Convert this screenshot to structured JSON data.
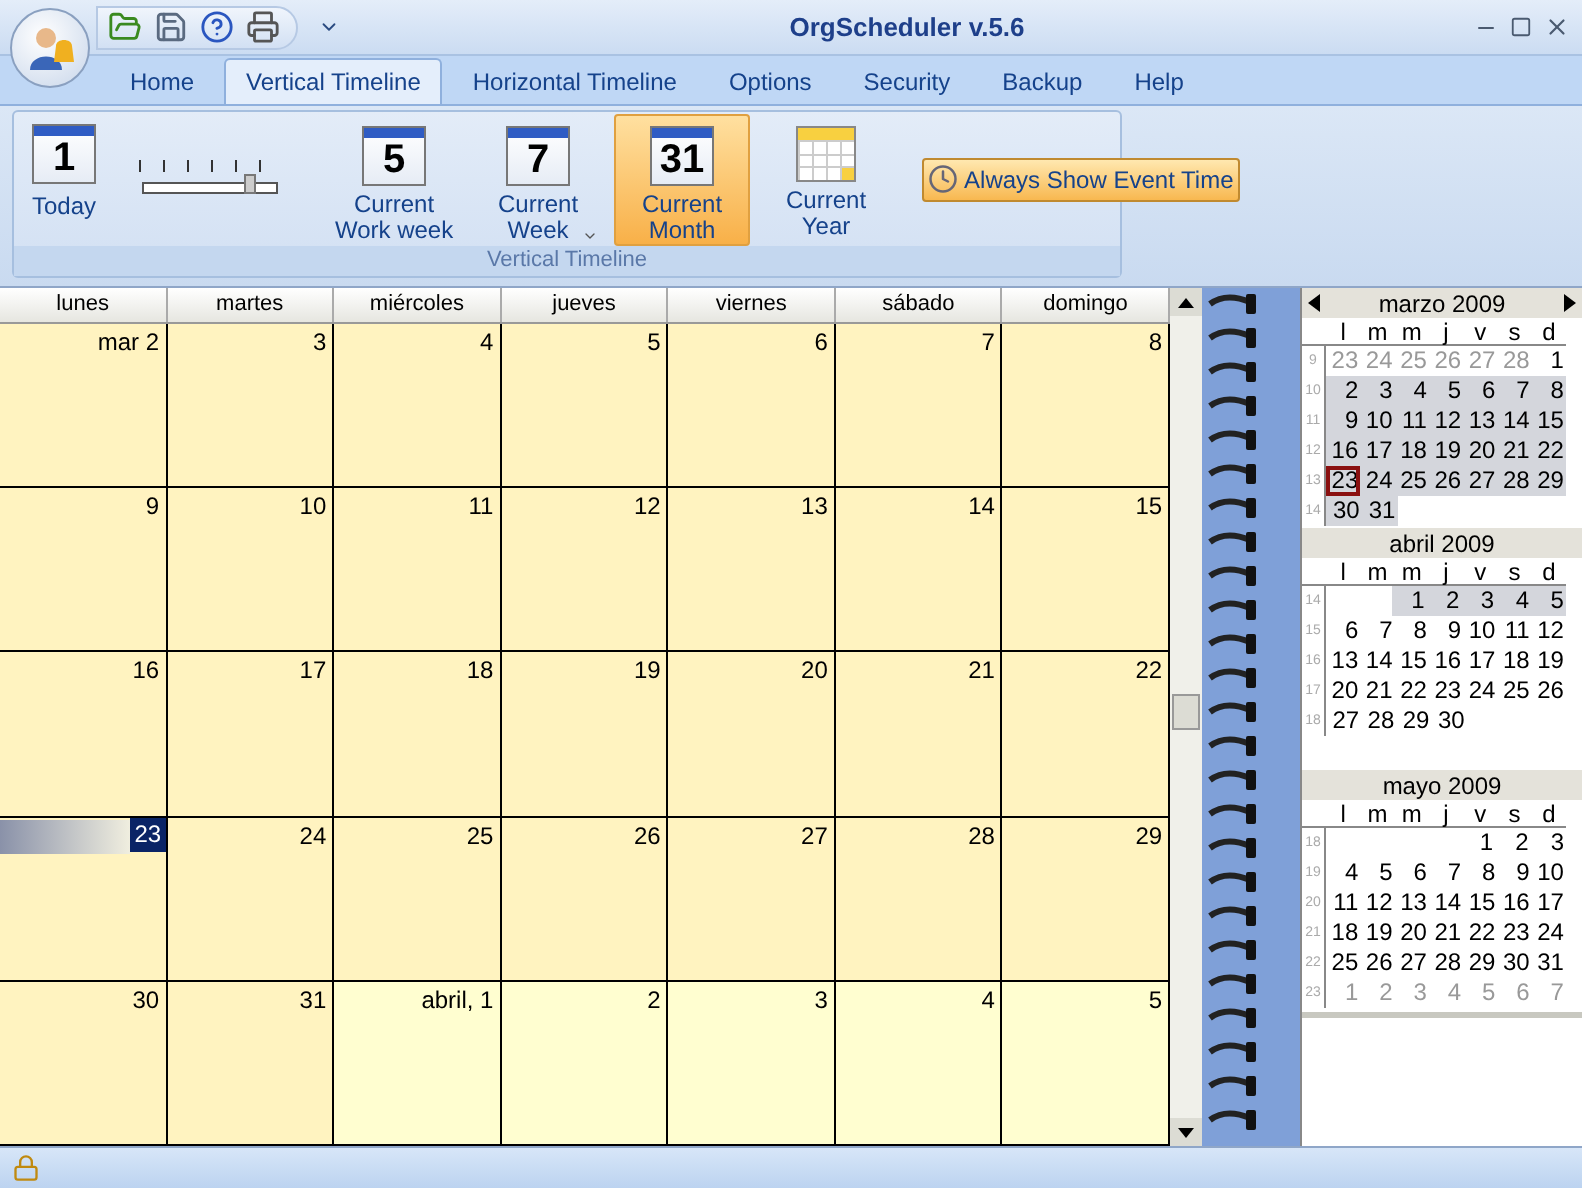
{
  "window": {
    "title": "OrgScheduler v.5.6"
  },
  "tabs": [
    {
      "label": "Home",
      "selected": false
    },
    {
      "label": "Vertical Timeline",
      "selected": true
    },
    {
      "label": "Horizontal Timeline",
      "selected": false
    },
    {
      "label": "Options",
      "selected": false
    },
    {
      "label": "Security",
      "selected": false
    },
    {
      "label": "Backup",
      "selected": false
    },
    {
      "label": "Help",
      "selected": false
    }
  ],
  "ribbon": {
    "group_label": "Vertical Timeline",
    "today": {
      "icon_text": "1",
      "label": "Today"
    },
    "zoom_slider": {
      "level": 0.8
    },
    "view_buttons": [
      {
        "kind": "number",
        "icon_text": "5",
        "label": "Current Work week",
        "selected": false,
        "dropdown": false
      },
      {
        "kind": "number",
        "icon_text": "7",
        "label": "Current Week",
        "selected": false,
        "dropdown": true
      },
      {
        "kind": "number",
        "icon_text": "31",
        "label": "Current Month",
        "selected": true,
        "dropdown": false
      },
      {
        "kind": "grid",
        "label": "Current Year",
        "selected": false,
        "dropdown": false
      }
    ],
    "event_time_toggle": {
      "label": "Always Show Event Time",
      "on": true
    }
  },
  "month_view": {
    "day_headers": [
      "lunes",
      "martes",
      "miércoles",
      "jueves",
      "viernes",
      "sábado",
      "domingo"
    ],
    "weeks": [
      [
        {
          "label": "mar 2",
          "selected": false,
          "other_month": false
        },
        {
          "label": "3",
          "selected": false,
          "other_month": false
        },
        {
          "label": "4",
          "selected": false,
          "other_month": false
        },
        {
          "label": "5",
          "selected": false,
          "other_month": false
        },
        {
          "label": "6",
          "selected": false,
          "other_month": false
        },
        {
          "label": "7",
          "selected": false,
          "other_month": false
        },
        {
          "label": "8",
          "selected": false,
          "other_month": false
        }
      ],
      [
        {
          "label": "9",
          "selected": false,
          "other_month": false
        },
        {
          "label": "10",
          "selected": false,
          "other_month": false
        },
        {
          "label": "11",
          "selected": false,
          "other_month": false
        },
        {
          "label": "12",
          "selected": false,
          "other_month": false
        },
        {
          "label": "13",
          "selected": false,
          "other_month": false
        },
        {
          "label": "14",
          "selected": false,
          "other_month": false
        },
        {
          "label": "15",
          "selected": false,
          "other_month": false
        }
      ],
      [
        {
          "label": "16",
          "selected": false,
          "other_month": false
        },
        {
          "label": "17",
          "selected": false,
          "other_month": false
        },
        {
          "label": "18",
          "selected": false,
          "other_month": false
        },
        {
          "label": "19",
          "selected": false,
          "other_month": false
        },
        {
          "label": "20",
          "selected": false,
          "other_month": false
        },
        {
          "label": "21",
          "selected": false,
          "other_month": false
        },
        {
          "label": "22",
          "selected": false,
          "other_month": false
        }
      ],
      [
        {
          "label": "23",
          "selected": true,
          "other_month": false
        },
        {
          "label": "24",
          "selected": false,
          "other_month": false
        },
        {
          "label": "25",
          "selected": false,
          "other_month": false
        },
        {
          "label": "26",
          "selected": false,
          "other_month": false
        },
        {
          "label": "27",
          "selected": false,
          "other_month": false
        },
        {
          "label": "28",
          "selected": false,
          "other_month": false
        },
        {
          "label": "29",
          "selected": false,
          "other_month": false
        }
      ],
      [
        {
          "label": "30",
          "selected": false,
          "other_month": false
        },
        {
          "label": "31",
          "selected": false,
          "other_month": false
        },
        {
          "label": "abril, 1",
          "selected": false,
          "other_month": true
        },
        {
          "label": "2",
          "selected": false,
          "other_month": true
        },
        {
          "label": "3",
          "selected": false,
          "other_month": true
        },
        {
          "label": "4",
          "selected": false,
          "other_month": true
        },
        {
          "label": "5",
          "selected": false,
          "other_month": true
        }
      ]
    ]
  },
  "mini_calendars": [
    {
      "title": "marzo 2009",
      "nav": true,
      "weekdays": [
        "l",
        "m",
        "m",
        "j",
        "v",
        "s",
        "d"
      ],
      "weeks": [
        {
          "number": "9",
          "highlighted": false,
          "days": [
            {
              "kind": "day",
              "label": "23",
              "muted": true,
              "today": false
            },
            {
              "kind": "day",
              "label": "24",
              "muted": true,
              "today": false
            },
            {
              "kind": "day",
              "label": "25",
              "muted": true,
              "today": false
            },
            {
              "kind": "day",
              "label": "26",
              "muted": true,
              "today": false
            },
            {
              "kind": "day",
              "label": "27",
              "muted": true,
              "today": false
            },
            {
              "kind": "day",
              "label": "28",
              "muted": true,
              "today": false
            },
            {
              "kind": "day",
              "label": "1",
              "muted": false,
              "today": false
            }
          ]
        },
        {
          "number": "10",
          "highlighted": true,
          "days": [
            {
              "kind": "day",
              "label": "2",
              "muted": false,
              "today": false
            },
            {
              "kind": "day",
              "label": "3",
              "muted": false,
              "today": false
            },
            {
              "kind": "day",
              "label": "4",
              "muted": false,
              "today": false
            },
            {
              "kind": "day",
              "label": "5",
              "muted": false,
              "today": false
            },
            {
              "kind": "day",
              "label": "6",
              "muted": false,
              "today": false
            },
            {
              "kind": "day",
              "label": "7",
              "muted": false,
              "today": false
            },
            {
              "kind": "day",
              "label": "8",
              "muted": false,
              "today": false
            }
          ]
        },
        {
          "number": "11",
          "highlighted": true,
          "days": [
            {
              "kind": "day",
              "label": "9",
              "muted": false,
              "today": false
            },
            {
              "kind": "day",
              "label": "10",
              "muted": false,
              "today": false
            },
            {
              "kind": "day",
              "label": "11",
              "muted": false,
              "today": false
            },
            {
              "kind": "day",
              "label": "12",
              "muted": false,
              "today": false
            },
            {
              "kind": "day",
              "label": "13",
              "muted": false,
              "today": false
            },
            {
              "kind": "day",
              "label": "14",
              "muted": false,
              "today": false
            },
            {
              "kind": "day",
              "label": "15",
              "muted": false,
              "today": false
            }
          ]
        },
        {
          "number": "12",
          "highlighted": true,
          "days": [
            {
              "kind": "day",
              "label": "16",
              "muted": false,
              "today": false
            },
            {
              "kind": "day",
              "label": "17",
              "muted": false,
              "today": false
            },
            {
              "kind": "day",
              "label": "18",
              "muted": false,
              "today": false
            },
            {
              "kind": "day",
              "label": "19",
              "muted": false,
              "today": false
            },
            {
              "kind": "day",
              "label": "20",
              "muted": false,
              "today": false
            },
            {
              "kind": "day",
              "label": "21",
              "muted": false,
              "today": false
            },
            {
              "kind": "day",
              "label": "22",
              "muted": false,
              "today": false
            }
          ]
        },
        {
          "number": "13",
          "highlighted": true,
          "days": [
            {
              "kind": "day",
              "label": "23",
              "muted": false,
              "today": true
            },
            {
              "kind": "day",
              "label": "24",
              "muted": false,
              "today": false
            },
            {
              "kind": "day",
              "label": "25",
              "muted": false,
              "today": false
            },
            {
              "kind": "day",
              "label": "26",
              "muted": false,
              "today": false
            },
            {
              "kind": "day",
              "label": "27",
              "muted": false,
              "today": false
            },
            {
              "kind": "day",
              "label": "28",
              "muted": false,
              "today": false
            },
            {
              "kind": "day",
              "label": "29",
              "muted": false,
              "today": false
            }
          ]
        },
        {
          "number": "14",
          "highlighted": true,
          "days": [
            {
              "kind": "day",
              "label": "30",
              "muted": false,
              "today": false
            },
            {
              "kind": "day",
              "label": "31",
              "muted": false,
              "today": false
            },
            {
              "kind": "blank"
            },
            {
              "kind": "blank"
            },
            {
              "kind": "blank"
            },
            {
              "kind": "blank"
            },
            {
              "kind": "blank"
            }
          ]
        }
      ]
    },
    {
      "title": "abril 2009",
      "nav": false,
      "weekdays": [
        "l",
        "m",
        "m",
        "j",
        "v",
        "s",
        "d"
      ],
      "weeks": [
        {
          "number": "14",
          "highlighted": true,
          "days": [
            {
              "kind": "blank"
            },
            {
              "kind": "blank"
            },
            {
              "kind": "day",
              "label": "1",
              "muted": false,
              "today": false
            },
            {
              "kind": "day",
              "label": "2",
              "muted": false,
              "today": false
            },
            {
              "kind": "day",
              "label": "3",
              "muted": false,
              "today": false
            },
            {
              "kind": "day",
              "label": "4",
              "muted": false,
              "today": false
            },
            {
              "kind": "day",
              "label": "5",
              "muted": false,
              "today": false
            }
          ]
        },
        {
          "number": "15",
          "highlighted": false,
          "days": [
            {
              "kind": "day",
              "label": "6",
              "muted": false,
              "today": false
            },
            {
              "kind": "day",
              "label": "7",
              "muted": false,
              "today": false
            },
            {
              "kind": "day",
              "label": "8",
              "muted": false,
              "today": false
            },
            {
              "kind": "day",
              "label": "9",
              "muted": false,
              "today": false
            },
            {
              "kind": "day",
              "label": "10",
              "muted": false,
              "today": false
            },
            {
              "kind": "day",
              "label": "11",
              "muted": false,
              "today": false
            },
            {
              "kind": "day",
              "label": "12",
              "muted": false,
              "today": false
            }
          ]
        },
        {
          "number": "16",
          "highlighted": false,
          "days": [
            {
              "kind": "day",
              "label": "13",
              "muted": false,
              "today": false
            },
            {
              "kind": "day",
              "label": "14",
              "muted": false,
              "today": false
            },
            {
              "kind": "day",
              "label": "15",
              "muted": false,
              "today": false
            },
            {
              "kind": "day",
              "label": "16",
              "muted": false,
              "today": false
            },
            {
              "kind": "day",
              "label": "17",
              "muted": false,
              "today": false
            },
            {
              "kind": "day",
              "label": "18",
              "muted": false,
              "today": false
            },
            {
              "kind": "day",
              "label": "19",
              "muted": false,
              "today": false
            }
          ]
        },
        {
          "number": "17",
          "highlighted": false,
          "days": [
            {
              "kind": "day",
              "label": "20",
              "muted": false,
              "today": false
            },
            {
              "kind": "day",
              "label": "21",
              "muted": false,
              "today": false
            },
            {
              "kind": "day",
              "label": "22",
              "muted": false,
              "today": false
            },
            {
              "kind": "day",
              "label": "23",
              "muted": false,
              "today": false
            },
            {
              "kind": "day",
              "label": "24",
              "muted": false,
              "today": false
            },
            {
              "kind": "day",
              "label": "25",
              "muted": false,
              "today": false
            },
            {
              "kind": "day",
              "label": "26",
              "muted": false,
              "today": false
            }
          ]
        },
        {
          "number": "18",
          "highlighted": false,
          "days": [
            {
              "kind": "day",
              "label": "27",
              "muted": false,
              "today": false
            },
            {
              "kind": "day",
              "label": "28",
              "muted": false,
              "today": false
            },
            {
              "kind": "day",
              "label": "29",
              "muted": false,
              "today": false
            },
            {
              "kind": "day",
              "label": "30",
              "muted": false,
              "today": false
            },
            {
              "kind": "blank"
            },
            {
              "kind": "blank"
            },
            {
              "kind": "blank"
            }
          ]
        }
      ]
    },
    {
      "title": "mayo 2009",
      "nav": false,
      "weekdays": [
        "l",
        "m",
        "m",
        "j",
        "v",
        "s",
        "d"
      ],
      "weeks": [
        {
          "number": "18",
          "highlighted": false,
          "days": [
            {
              "kind": "blank"
            },
            {
              "kind": "blank"
            },
            {
              "kind": "blank"
            },
            {
              "kind": "blank"
            },
            {
              "kind": "day",
              "label": "1",
              "muted": false,
              "today": false
            },
            {
              "kind": "day",
              "label": "2",
              "muted": false,
              "today": false
            },
            {
              "kind": "day",
              "label": "3",
              "muted": false,
              "today": false
            }
          ]
        },
        {
          "number": "19",
          "highlighted": false,
          "days": [
            {
              "kind": "day",
              "label": "4",
              "muted": false,
              "today": false
            },
            {
              "kind": "day",
              "label": "5",
              "muted": false,
              "today": false
            },
            {
              "kind": "day",
              "label": "6",
              "muted": false,
              "today": false
            },
            {
              "kind": "day",
              "label": "7",
              "muted": false,
              "today": false
            },
            {
              "kind": "day",
              "label": "8",
              "muted": false,
              "today": false
            },
            {
              "kind": "day",
              "label": "9",
              "muted": false,
              "today": false
            },
            {
              "kind": "day",
              "label": "10",
              "muted": false,
              "today": false
            }
          ]
        },
        {
          "number": "20",
          "highlighted": false,
          "days": [
            {
              "kind": "day",
              "label": "11",
              "muted": false,
              "today": false
            },
            {
              "kind": "day",
              "label": "12",
              "muted": false,
              "today": false
            },
            {
              "kind": "day",
              "label": "13",
              "muted": false,
              "today": false
            },
            {
              "kind": "day",
              "label": "14",
              "muted": false,
              "today": false
            },
            {
              "kind": "day",
              "label": "15",
              "muted": false,
              "today": false
            },
            {
              "kind": "day",
              "label": "16",
              "muted": false,
              "today": false
            },
            {
              "kind": "day",
              "label": "17",
              "muted": false,
              "today": false
            }
          ]
        },
        {
          "number": "21",
          "highlighted": false,
          "days": [
            {
              "kind": "day",
              "label": "18",
              "muted": false,
              "today": false
            },
            {
              "kind": "day",
              "label": "19",
              "muted": false,
              "today": false
            },
            {
              "kind": "day",
              "label": "20",
              "muted": false,
              "today": false
            },
            {
              "kind": "day",
              "label": "21",
              "muted": false,
              "today": false
            },
            {
              "kind": "day",
              "label": "22",
              "muted": false,
              "today": false
            },
            {
              "kind": "day",
              "label": "23",
              "muted": false,
              "today": false
            },
            {
              "kind": "day",
              "label": "24",
              "muted": false,
              "today": false
            }
          ]
        },
        {
          "number": "22",
          "highlighted": false,
          "days": [
            {
              "kind": "day",
              "label": "25",
              "muted": false,
              "today": false
            },
            {
              "kind": "day",
              "label": "26",
              "muted": false,
              "today": false
            },
            {
              "kind": "day",
              "label": "27",
              "muted": false,
              "today": false
            },
            {
              "kind": "day",
              "label": "28",
              "muted": false,
              "today": false
            },
            {
              "kind": "day",
              "label": "29",
              "muted": false,
              "today": false
            },
            {
              "kind": "day",
              "label": "30",
              "muted": false,
              "today": false
            },
            {
              "kind": "day",
              "label": "31",
              "muted": false,
              "today": false
            }
          ]
        },
        {
          "number": "23",
          "highlighted": false,
          "days": [
            {
              "kind": "day",
              "label": "1",
              "muted": true,
              "today": false
            },
            {
              "kind": "day",
              "label": "2",
              "muted": true,
              "today": false
            },
            {
              "kind": "day",
              "label": "3",
              "muted": true,
              "today": false
            },
            {
              "kind": "day",
              "label": "4",
              "muted": true,
              "today": false
            },
            {
              "kind": "day",
              "label": "5",
              "muted": true,
              "today": false
            },
            {
              "kind": "day",
              "label": "6",
              "muted": true,
              "today": false
            },
            {
              "kind": "day",
              "label": "7",
              "muted": true,
              "today": false
            }
          ]
        }
      ]
    }
  ]
}
